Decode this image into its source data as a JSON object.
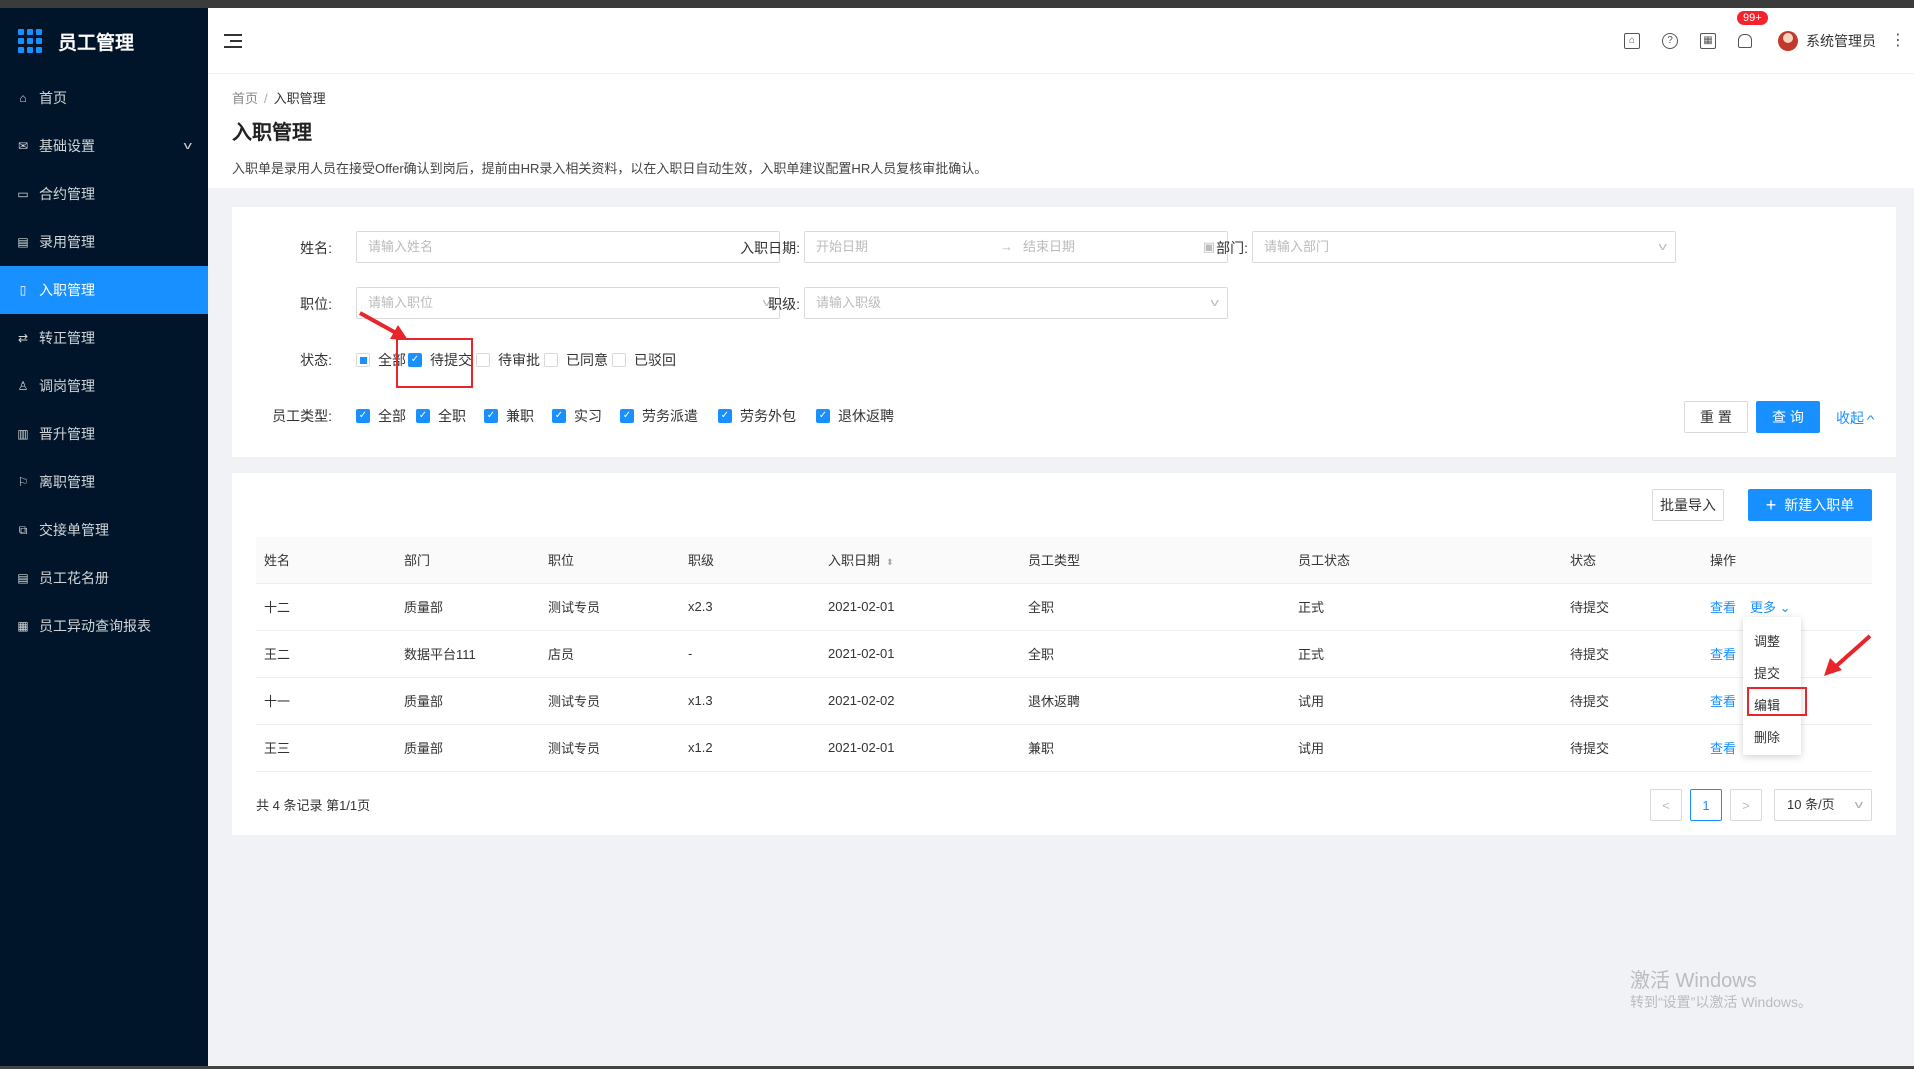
{
  "app": {
    "title": "员工管理"
  },
  "sidebar": {
    "items": [
      {
        "label": "首页",
        "icon": "home-icon"
      },
      {
        "label": "基础设置",
        "icon": "mail-icon"
      },
      {
        "label": "合约管理",
        "icon": "calendar-icon"
      },
      {
        "label": "录用管理",
        "icon": "form-icon"
      },
      {
        "label": "入职管理",
        "icon": "file-icon"
      },
      {
        "label": "转正管理",
        "icon": "swap-icon"
      },
      {
        "label": "调岗管理",
        "icon": "user-icon"
      },
      {
        "label": "晋升管理",
        "icon": "rise-icon"
      },
      {
        "label": "离职管理",
        "icon": "leave-icon"
      },
      {
        "label": "交接单管理",
        "icon": "copy-icon"
      },
      {
        "label": "员工花名册",
        "icon": "roster-icon"
      },
      {
        "label": "员工异动查询报表",
        "icon": "report-icon"
      }
    ],
    "active_index": 4
  },
  "header": {
    "notification_count": "99+",
    "user_name": "系统管理员"
  },
  "breadcrumb": {
    "home": "首页",
    "sep": "/",
    "current": "入职管理"
  },
  "page": {
    "title": "入职管理",
    "description": "入职单是录用人员在接受Offer确认到岗后，提前由HR录入相关资料，以在入职日自动生效，入职单建议配置HR人员复核审批确认。"
  },
  "filter": {
    "name_label": "姓名:",
    "name_placeholder": "请输入姓名",
    "date_label": "入职日期:",
    "date_start_placeholder": "开始日期",
    "date_end_placeholder": "结束日期",
    "dept_label": "部门:",
    "dept_placeholder": "请输入部门",
    "position_label": "职位:",
    "position_placeholder": "请输入职位",
    "level_label": "职级:",
    "level_placeholder": "请输入职级",
    "status_label": "状态:",
    "status_options": [
      {
        "label": "全部",
        "state": "indeterminate"
      },
      {
        "label": "待提交",
        "state": "checked"
      },
      {
        "label": "待审批",
        "state": "unchecked"
      },
      {
        "label": "已同意",
        "state": "unchecked"
      },
      {
        "label": "已驳回",
        "state": "unchecked"
      }
    ],
    "emptype_label": "员工类型:",
    "emptype_options": [
      {
        "label": "全部",
        "state": "checked"
      },
      {
        "label": "全职",
        "state": "checked"
      },
      {
        "label": "兼职",
        "state": "checked"
      },
      {
        "label": "实习",
        "state": "checked"
      },
      {
        "label": "劳务派遣",
        "state": "checked"
      },
      {
        "label": "劳务外包",
        "state": "checked"
      },
      {
        "label": "退休返聘",
        "state": "checked"
      }
    ],
    "reset_label": "重 置",
    "query_label": "查 询",
    "collapse_label": "收起"
  },
  "toolbar": {
    "import_label": "批量导入",
    "new_label": "新建入职单"
  },
  "table": {
    "columns": [
      "姓名",
      "部门",
      "职位",
      "职级",
      "入职日期",
      "员工类型",
      "员工状态",
      "状态",
      "操作"
    ],
    "rows": [
      [
        "十二",
        "质量部",
        "测试专员",
        "x2.3",
        "2021-02-01",
        "全职",
        "正式",
        "待提交"
      ],
      [
        "王二",
        "数据平台111",
        "店员",
        "-",
        "2021-02-01",
        "全职",
        "正式",
        "待提交"
      ],
      [
        "十一",
        "质量部",
        "测试专员",
        "x1.3",
        "2021-02-02",
        "退休返聘",
        "试用",
        "待提交"
      ],
      [
        "王三",
        "质量部",
        "测试专员",
        "x1.2",
        "2021-02-01",
        "兼职",
        "试用",
        "待提交"
      ]
    ],
    "view_label": "查看",
    "more_label": "更多"
  },
  "dropdown": {
    "items": [
      "调整",
      "提交",
      "编辑",
      "删除"
    ]
  },
  "pagination": {
    "total_text": "共 4 条记录 第1/1页",
    "current_page": "1",
    "page_size": "10 条/页"
  },
  "watermark": {
    "line1": "激活 Windows",
    "line2": "转到“设置”以激活 Windows。"
  },
  "colors": {
    "sidebar": "#001529",
    "primary": "#1890ff",
    "annotation": "#e8252a"
  }
}
